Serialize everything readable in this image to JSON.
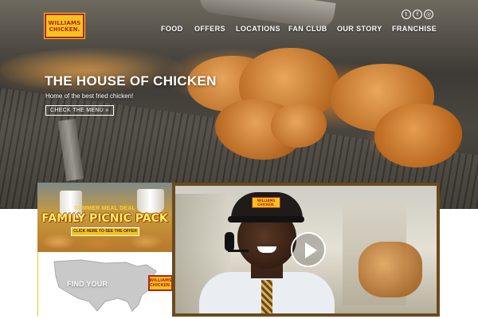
{
  "brand": {
    "logo_line1": "WILLIAMS",
    "logo_line2": "CHICKEN.",
    "primary_yellow": "#f6c21c",
    "primary_red": "#b3231f"
  },
  "nav": {
    "items": [
      "FOOD",
      "OFFERS",
      "LOCATIONS",
      "FAN CLUB",
      "OUR STORY",
      "FRANCHISE"
    ]
  },
  "social": {
    "icons": [
      "twitter-icon",
      "facebook-icon",
      "instagram-icon"
    ],
    "glyphs": [
      "t",
      "f",
      "◎"
    ]
  },
  "hero": {
    "title": "THE HOUSE OF CHICKEN",
    "subtitle": "Home of the best fried chicken!",
    "cta": "CHECK THE MENU »"
  },
  "promo": {
    "deal_label": "SUMMER MEAL DEAL",
    "title": "FAMILY PICNIC PACK",
    "cta": "CLICK HERE TO SEE THE OFFER"
  },
  "finder": {
    "label": "FIND YOUR",
    "logo_line1": "WILLIAMS",
    "logo_line2": "CHICKEN."
  },
  "video": {
    "cap_logo_line1": "WILLIAMS",
    "cap_logo_line2": "CHICKEN.",
    "frame_color": "#6b4a1d"
  }
}
